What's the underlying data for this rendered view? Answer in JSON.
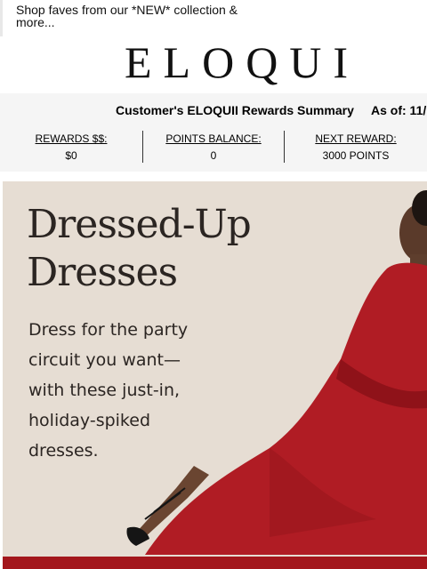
{
  "preheader": {
    "text": "Shop faves from our *NEW* collection & more..."
  },
  "brand": {
    "logo": "ELOQUI"
  },
  "rewards": {
    "title": "Customer's ELOQUII Rewards Summary",
    "as_of": "As of: 11/",
    "items": [
      {
        "label": "REWARDS $$:",
        "value": "$0"
      },
      {
        "label": "POINTS BALANCE:",
        "value": "0"
      },
      {
        "label": "NEXT REWARD:",
        "value": "3000 POINTS"
      }
    ]
  },
  "hero": {
    "headline": "Dressed-Up Dresses",
    "subtext": "Dress for the party circuit you want—with these just-in, holiday-spiked dresses.",
    "colors": {
      "dress": "#b01c24",
      "background": "#e6ddd3"
    }
  }
}
